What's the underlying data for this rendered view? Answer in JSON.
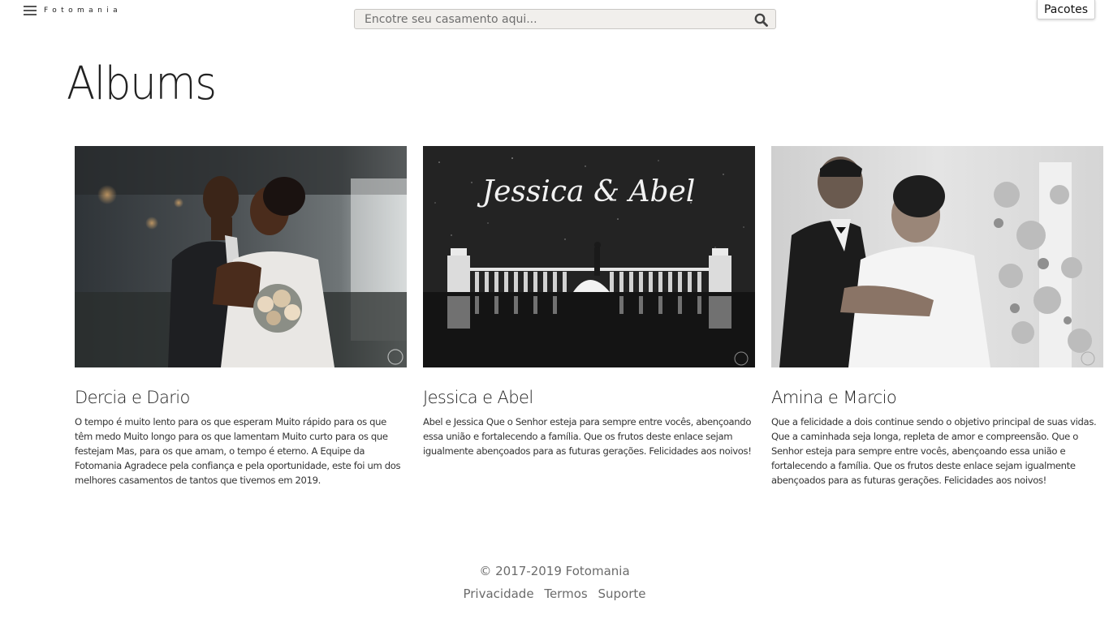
{
  "header": {
    "brand": "Fotomania",
    "menu_icon": "hamburger-menu-icon",
    "search": {
      "placeholder": "Encotre seu casamento aqui...",
      "value": "",
      "icon": "search-icon"
    },
    "packages_label": "Pacotes"
  },
  "main": {
    "title": "Albums",
    "albums": [
      {
        "name": "Dercia e Dario",
        "description": "O tempo é muito lento para os que esperam Muito rápido para os que têm medo Muito longo para os que lamentam Muito curto para os que festejam Mas, para os que amam, o tempo é eterno. A Equipe da Fotomania Agradece pela confiança e pela oportunidade, este foi um dos melhores casamentos de tantos que tivemos em 2019."
      },
      {
        "name": "Jessica e Abel",
        "photo_text": "Jessica & Abel",
        "description": "Abel e Jessica Que o Senhor esteja para sempre entre vocês, abençoando essa união e fortalecendo a família. Que os frutos deste enlace sejam igualmente abençoados para as futuras gerações. Felicidades aos noivos!"
      },
      {
        "name": "Amina e Marcio",
        "description": "Que a felicidade a dois continue sendo o objetivo principal de suas vidas. Que a caminhada seja longa, repleta de amor e compreensão. Que o Senhor esteja para sempre entre vocês, abençoando essa união e fortalecendo a família. Que os frutos deste enlace sejam igualmente abençoados para as futuras gerações. Felicidades aos noivos!"
      }
    ]
  },
  "footer": {
    "copyright": "© 2017-2019 Fotomania",
    "links": [
      "Privacidade",
      "Termos",
      "Suporte"
    ]
  }
}
